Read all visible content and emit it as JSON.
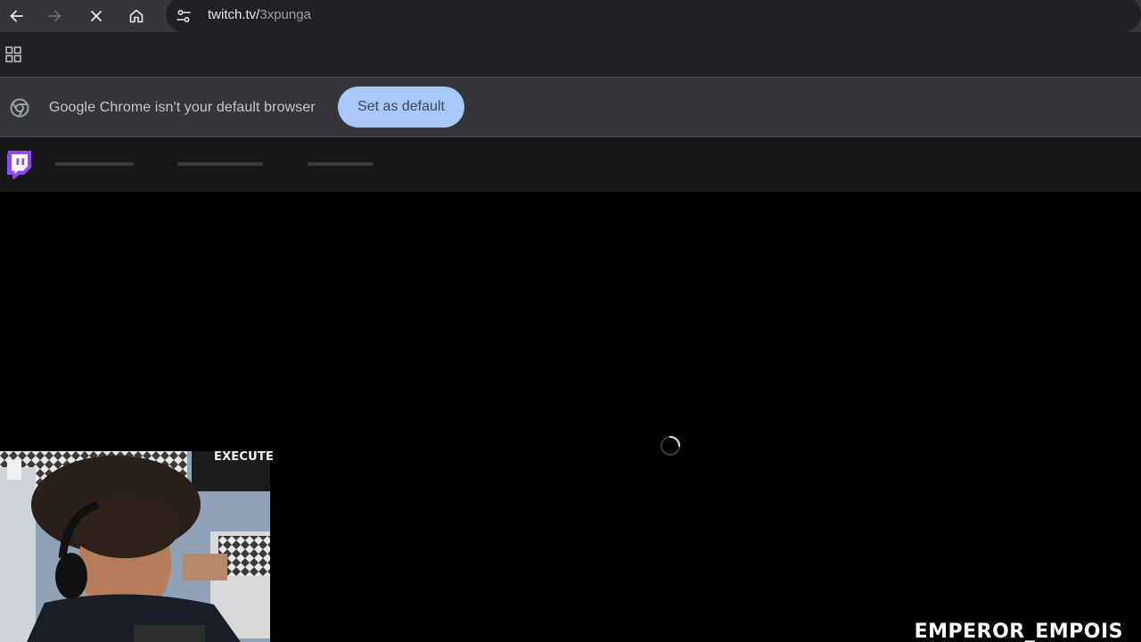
{
  "browser": {
    "url_host": "twitch.tv/",
    "url_path": "3xpunga",
    "icons": {
      "back": "back-arrow-icon",
      "forward": "forward-arrow-icon",
      "stop": "close-icon",
      "home": "home-icon",
      "site_info": "tune-icon",
      "apps": "apps-grid-icon"
    }
  },
  "infobar": {
    "message": "Google Chrome isn't your default browser",
    "button_label": "Set as default"
  },
  "twitch": {
    "logo": "twitch-logo-icon",
    "brand_color": "#9146ff"
  },
  "page": {
    "loading": true
  },
  "stream_overlay": {
    "streamer_name": "EMPEROR_EMPOIS",
    "webcam_sign_text": "EXECUTE"
  },
  "colors": {
    "toolbar": "#35363a",
    "omnibox": "#202124",
    "bookmarks_bar": "#202124",
    "infobar": "#35363a",
    "button_bg": "#a8c7fa",
    "twitch_nav": "#18181b"
  }
}
